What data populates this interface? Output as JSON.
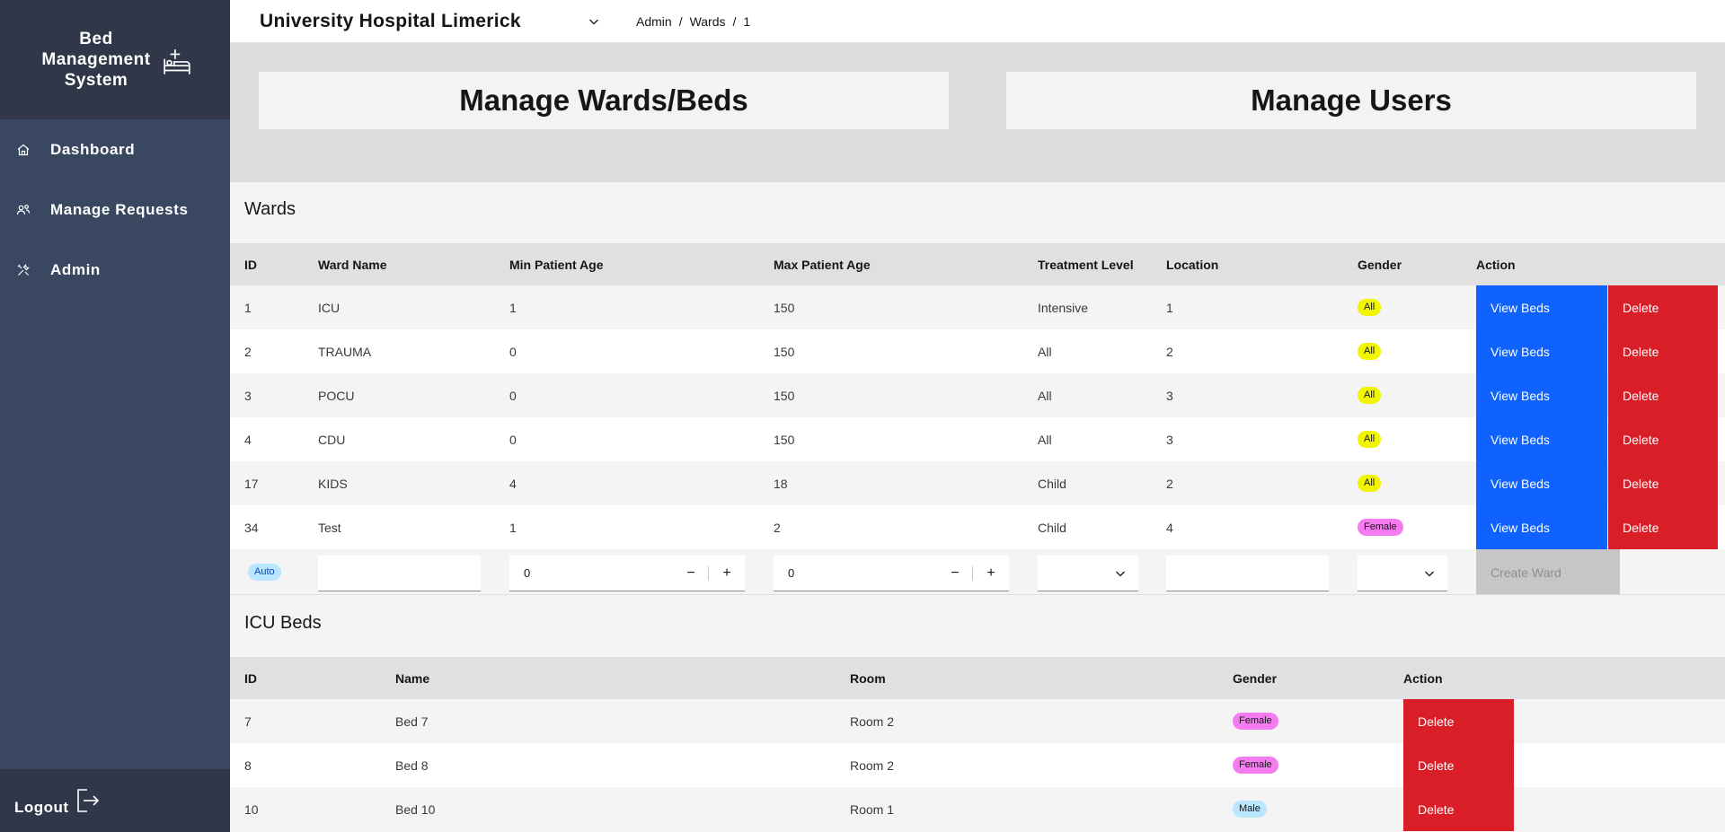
{
  "sidebar": {
    "brand_line1": "Bed",
    "brand_line2": "Management",
    "brand_line3": "System",
    "items": [
      {
        "label": "Dashboard",
        "icon": "home-icon"
      },
      {
        "label": "Manage Requests",
        "icon": "users-icon"
      },
      {
        "label": "Admin",
        "icon": "tools-icon"
      }
    ],
    "logout_label": "Logout"
  },
  "header": {
    "hospital": "University Hospital Limerick",
    "breadcrumb": [
      "Admin",
      "Wards",
      "1"
    ]
  },
  "tiles": {
    "wards": "Manage Wards/Beds",
    "users": "Manage Users"
  },
  "wards": {
    "title": "Wards",
    "columns": [
      "ID",
      "Ward Name",
      "Min Patient Age",
      "Max Patient Age",
      "Treatment Level",
      "Location",
      "Gender",
      "Action"
    ],
    "rows": [
      {
        "id": "1",
        "name": "ICU",
        "min": "1",
        "max": "150",
        "level": "Intensive",
        "location": "1",
        "gender": "All"
      },
      {
        "id": "2",
        "name": "TRAUMA",
        "min": "0",
        "max": "150",
        "level": "All",
        "location": "2",
        "gender": "All"
      },
      {
        "id": "3",
        "name": "POCU",
        "min": "0",
        "max": "150",
        "level": "All",
        "location": "3",
        "gender": "All"
      },
      {
        "id": "4",
        "name": "CDU",
        "min": "0",
        "max": "150",
        "level": "All",
        "location": "3",
        "gender": "All"
      },
      {
        "id": "17",
        "name": "KIDS",
        "min": "4",
        "max": "18",
        "level": "Child",
        "location": "2",
        "gender": "All"
      },
      {
        "id": "34",
        "name": "Test",
        "min": "1",
        "max": "2",
        "level": "Child",
        "location": "4",
        "gender": "Female"
      }
    ],
    "view_label": "View Beds",
    "delete_label": "Delete",
    "new_row": {
      "id_badge": "Auto",
      "name_value": "",
      "min_value": "0",
      "max_value": "0",
      "minus": "−",
      "plus": "+",
      "create_label": "Create Ward"
    }
  },
  "beds": {
    "title": "ICU Beds",
    "columns": [
      "ID",
      "Name",
      "Room",
      "Gender",
      "Action"
    ],
    "rows": [
      {
        "id": "7",
        "name": "Bed 7",
        "room": "Room 2",
        "gender": "Female"
      },
      {
        "id": "8",
        "name": "Bed 8",
        "room": "Room 2",
        "gender": "Female"
      },
      {
        "id": "10",
        "name": "Bed 10",
        "room": "Room 1",
        "gender": "Male"
      }
    ],
    "delete_label": "Delete"
  },
  "colors": {
    "sidebar_bg": "#394761",
    "badge_all": "#f1f500",
    "badge_female": "#f67bf0",
    "badge_male": "#bae6ff",
    "badge_auto": "#bae6ff",
    "primary": "#0f62fe",
    "danger": "#da1e28"
  }
}
